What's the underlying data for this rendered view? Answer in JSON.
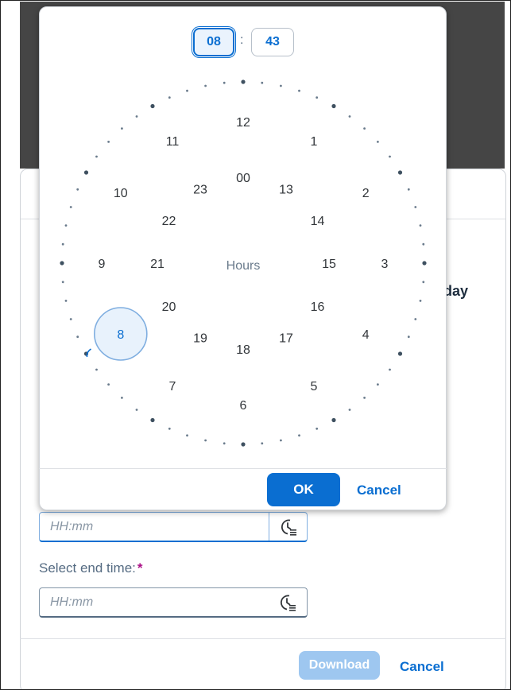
{
  "dialog": {
    "partial_text": "day",
    "start_time_input": {
      "placeholder": "HH:mm",
      "icon": "time-entry-icon"
    },
    "end_time_label": "Select end time:",
    "required_marker": "*",
    "end_time_input": {
      "placeholder": "HH:mm",
      "icon": "time-entry-icon"
    },
    "download_label": "Download",
    "cancel_label": "Cancel"
  },
  "picker": {
    "hours_value": "08",
    "separator": ":",
    "minutes_value": "43",
    "center_label": "Hours",
    "outer_ring": [
      "12",
      "1",
      "2",
      "3",
      "4",
      "5",
      "6",
      "7",
      "8",
      "9",
      "10",
      "11"
    ],
    "inner_ring": [
      "00",
      "13",
      "14",
      "15",
      "16",
      "17",
      "18",
      "19",
      "20",
      "21",
      "22",
      "23"
    ],
    "selected_hour": "8",
    "ok_label": "OK",
    "cancel_label": "Cancel"
  },
  "colors": {
    "accent": "#0a6ed1",
    "required": "#aa0f86",
    "disabled_button": "#9ec7f0",
    "overlay": "#454545"
  }
}
